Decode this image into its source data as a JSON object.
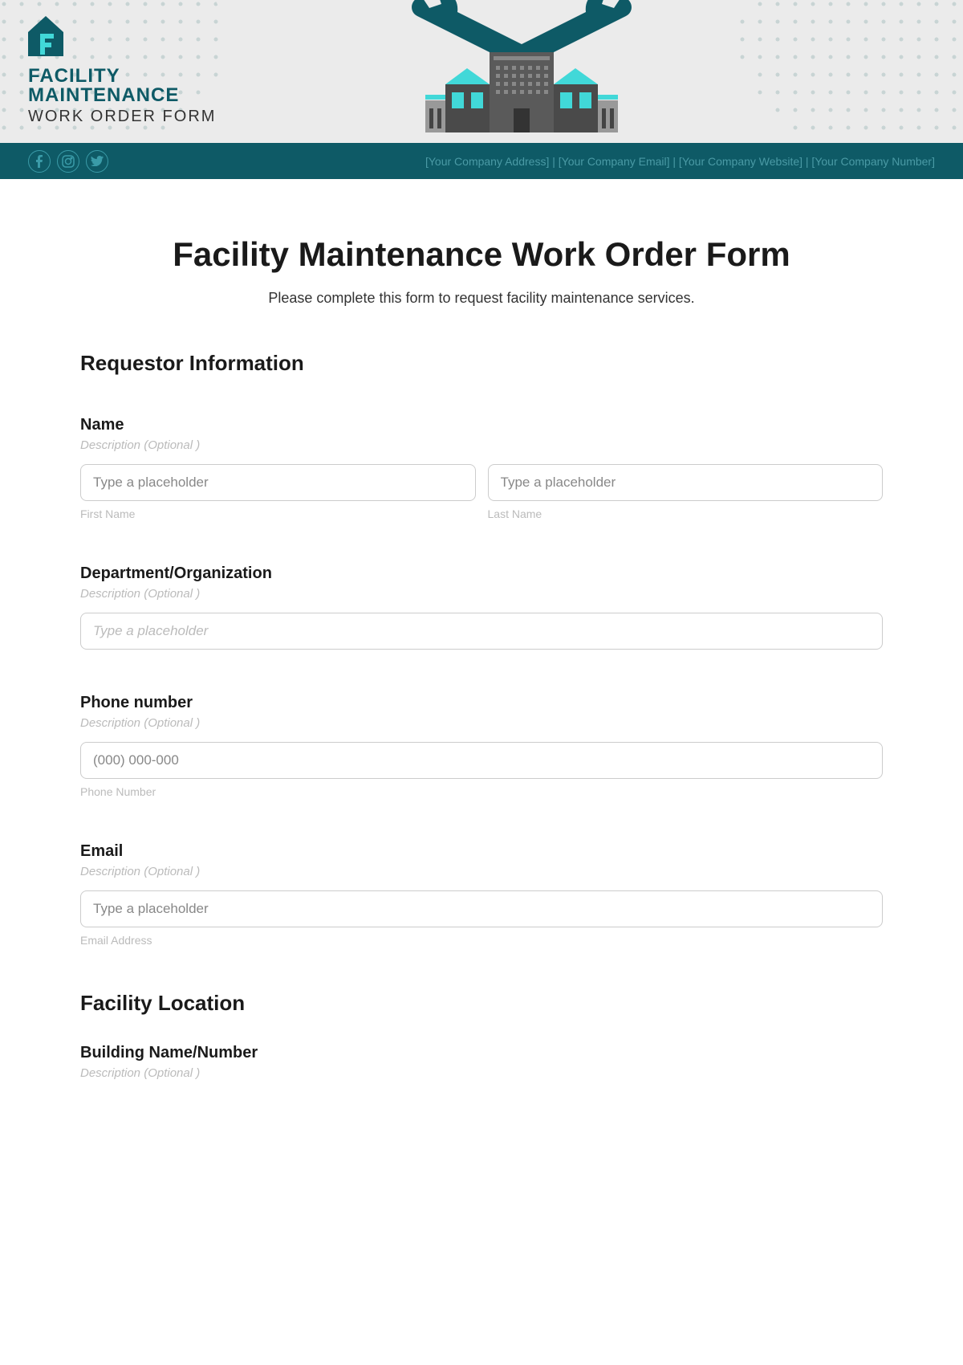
{
  "header": {
    "logo": {
      "line1": "FACILITY",
      "line2": "MAINTENANCE",
      "line3": "WORK ORDER FORM"
    },
    "companyInfo": "[Your Company Address] | [Your Company Email] | [Your Company Website] | [Your Company Number]"
  },
  "form": {
    "title": "Facility Maintenance Work Order Form",
    "subtitle": "Please complete this form to request facility maintenance services.",
    "sections": {
      "requestor": {
        "title": "Requestor Information",
        "fields": {
          "name": {
            "label": "Name",
            "description": "Description (Optional )",
            "firstName": {
              "placeholder": "Type a placeholder",
              "subLabel": "First Name"
            },
            "lastName": {
              "placeholder": "Type a placeholder",
              "subLabel": "Last Name"
            }
          },
          "department": {
            "label": "Department/Organization",
            "description": "Description (Optional )",
            "placeholder": "Type a placeholder"
          },
          "phone": {
            "label": "Phone number",
            "description": "Description (Optional )",
            "placeholder": "(000) 000-000",
            "subLabel": "Phone Number"
          },
          "email": {
            "label": "Email",
            "description": "Description (Optional )",
            "placeholder": "Type a placeholder",
            "subLabel": "Email Address"
          }
        }
      },
      "facility": {
        "title": "Facility Location",
        "fields": {
          "building": {
            "label": "Building Name/Number",
            "description": "Description (Optional )"
          }
        }
      }
    }
  }
}
